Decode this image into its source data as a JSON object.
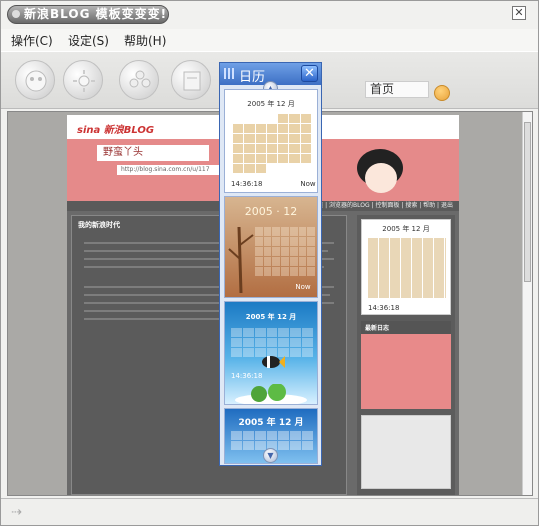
{
  "window": {
    "title": "新浪BLOG 模板变变变!",
    "close": "✕"
  },
  "menu": {
    "items": [
      "操作(C)",
      "设定(S)",
      "帮助(H)"
    ]
  },
  "toolbar": {
    "address": "首页"
  },
  "popup": {
    "title": "日历",
    "close": "✕",
    "up_arrow": "▲",
    "down_arrow": "▼",
    "cards": [
      {
        "header": "2005 年 12 月",
        "time": "14:36:18",
        "label": "Now",
        "theme": "beige"
      },
      {
        "header": "2005 · 12",
        "label": "Now",
        "theme": "autumn"
      },
      {
        "header": "2005 年 12 月",
        "time": "14:36:18",
        "theme": "ocean"
      },
      {
        "header": "2005 年 12 月",
        "theme": "sky"
      }
    ]
  },
  "blog": {
    "logo": "sina 新浪BLOG",
    "name": "野蛮丫头",
    "url": "http://blog.sina.com.cn/u/117",
    "nav": "首页 | 浏览器的BLOG | 控制面板 | 搜索 | 帮助 | 退出",
    "post_title": "我的新浪时代",
    "side_cal": "2005 年 12 月",
    "side_time": "14:36:18",
    "news_title": "最新日志"
  },
  "colors": {
    "accent": "#3c6fc4",
    "banner": "#e58a8a"
  },
  "icons": [
    "face-icon",
    "sun-icon",
    "flower-icon",
    "frame-icon",
    "go-icon",
    "close-icon",
    "grid-icon",
    "arrow-icon"
  ]
}
